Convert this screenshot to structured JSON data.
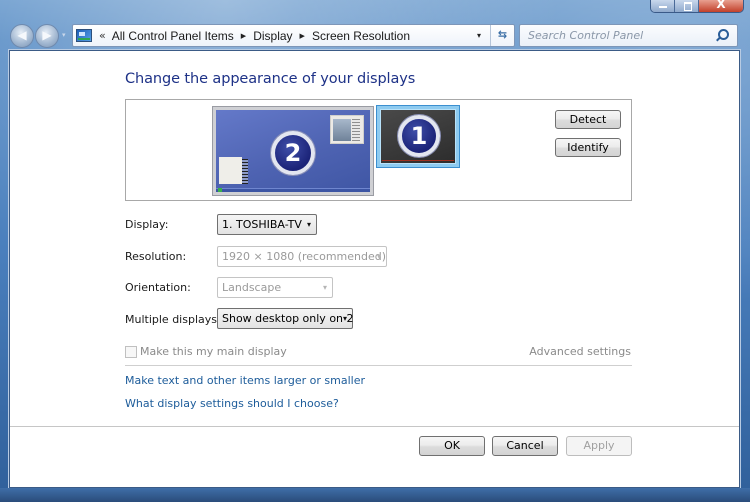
{
  "window": {
    "caption_buttons": {
      "minimize_icon": "minimize-icon",
      "maximize_icon": "maximize-icon",
      "close_icon": "close-icon",
      "close_glyph": "X"
    }
  },
  "nav": {
    "back_glyph": "◀",
    "forward_glyph": "▶",
    "recent_glyph": "▾"
  },
  "address_bar": {
    "icon": "control-panel-icon",
    "overflow_glyph": "«",
    "separator_glyph": "▶",
    "crumbs": [
      "All Control Panel Items",
      "Display",
      "Screen Resolution"
    ],
    "dropdown_glyph": "▾",
    "refresh_glyph": "⇆"
  },
  "search": {
    "placeholder": "Search Control Panel",
    "icon": "search-icon"
  },
  "main": {
    "title": "Change the appearance of your displays",
    "monitors": [
      {
        "number": "2",
        "selected": false
      },
      {
        "number": "1",
        "selected": true
      }
    ],
    "detect_label": "Detect",
    "identify_label": "Identify",
    "fields": {
      "display": {
        "label": "Display:",
        "value": "1. TOSHIBA-TV",
        "enabled": true
      },
      "resolution": {
        "label": "Resolution:",
        "value": "1920 × 1080 (recommended)",
        "enabled": false
      },
      "orientation": {
        "label": "Orientation:",
        "value": "Landscape",
        "enabled": false
      },
      "multiple_displays": {
        "label": "Multiple displays:",
        "value": "Show desktop only on 2",
        "enabled": true
      }
    },
    "dropdown_glyph": "▾",
    "main_display_checkbox": {
      "label": "Make this my main display",
      "checked": false,
      "enabled": false
    },
    "advanced_settings": "Advanced settings",
    "links": [
      "Make text and other items larger or smaller",
      "What display settings should I choose?"
    ]
  },
  "footer": {
    "ok_label": "OK",
    "cancel_label": "Cancel",
    "apply_label": "Apply"
  }
}
